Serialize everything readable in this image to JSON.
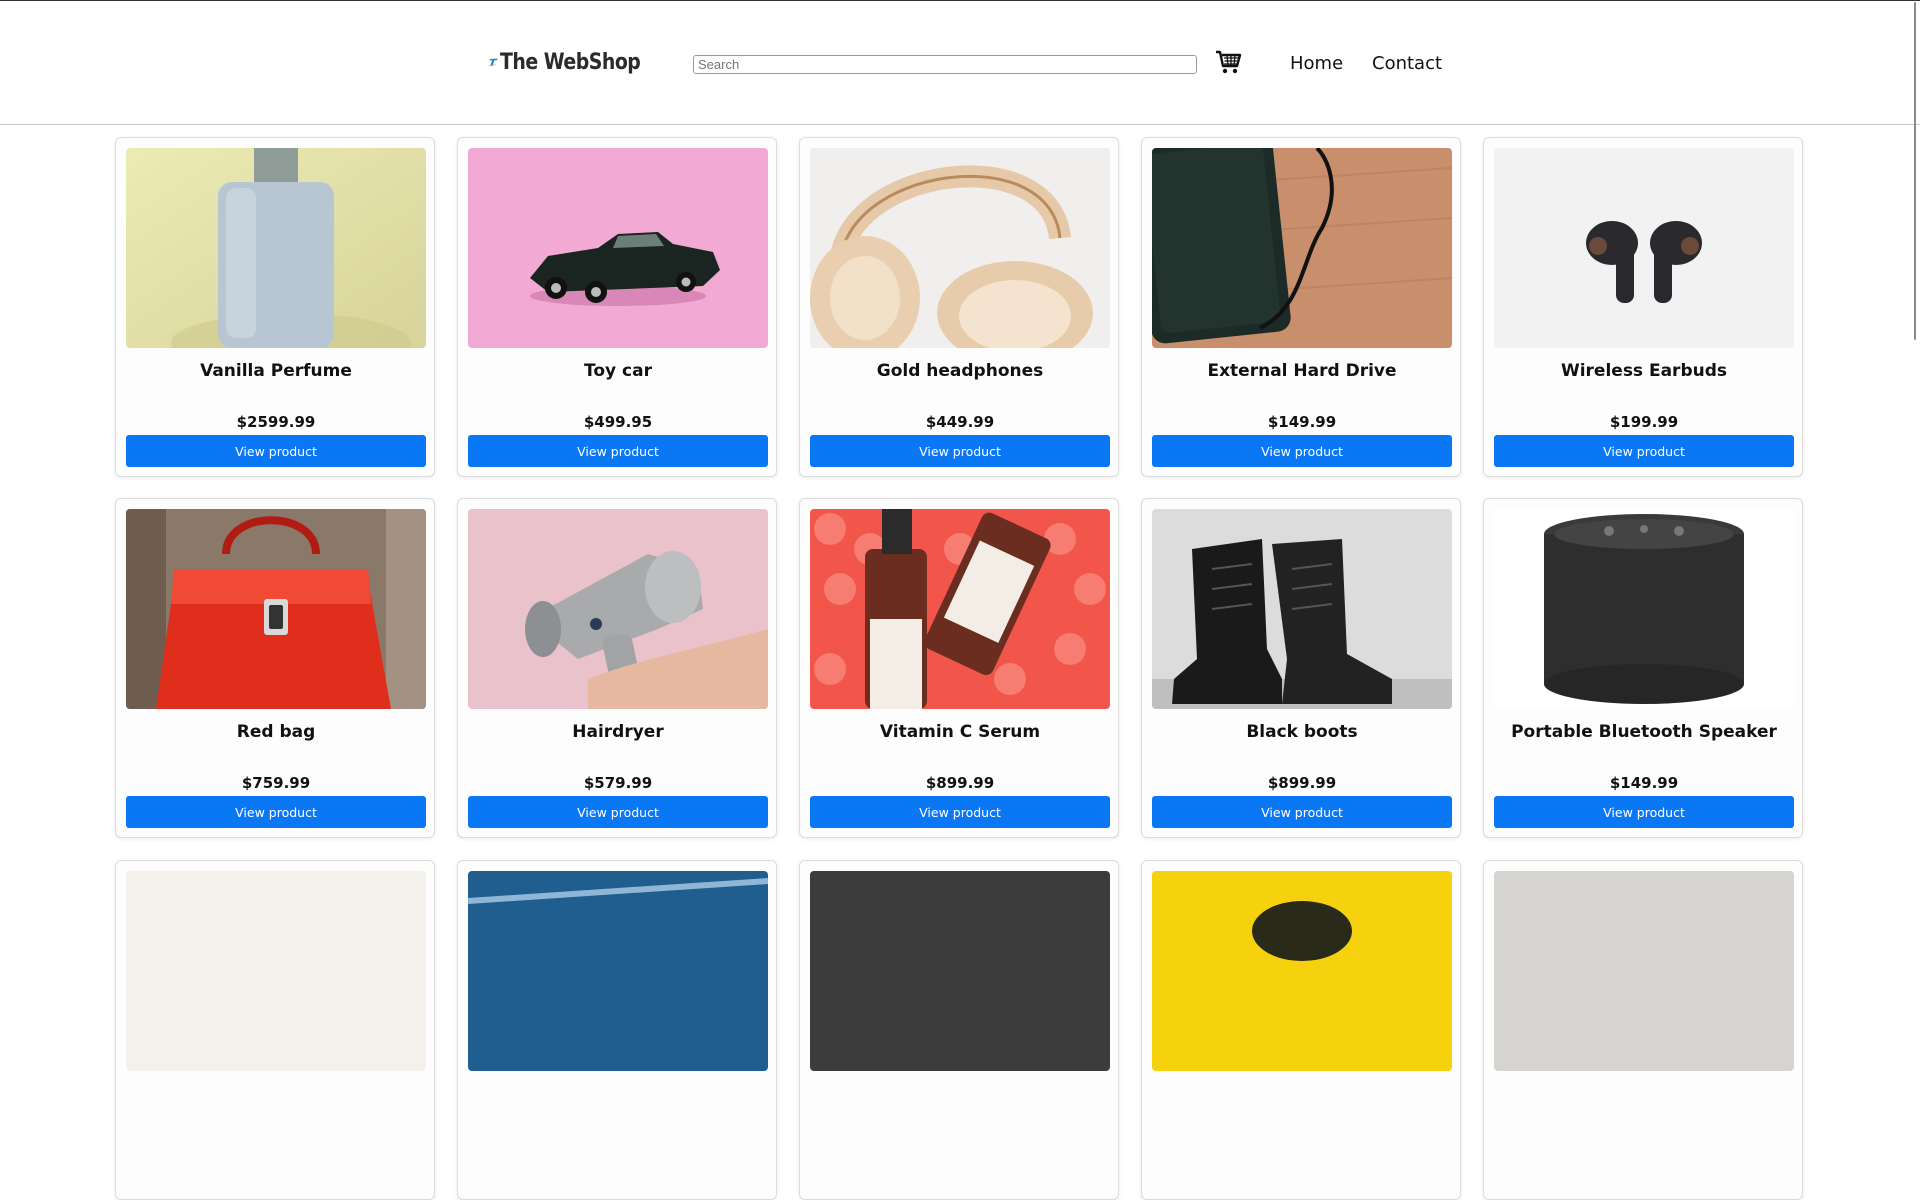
{
  "brand": {
    "name": "The WebShop",
    "logo_icon": "webshop-t-logo-icon"
  },
  "search": {
    "placeholder": "Search",
    "value": ""
  },
  "cart": {
    "icon": "shopping-cart-icon"
  },
  "nav": {
    "home": "Home",
    "contact": "Contact"
  },
  "colors": {
    "button": "#0a78f5",
    "logo_blue": "#1e82c8",
    "logo_orange": "#e8672a"
  },
  "products": [
    {
      "name": "Vanilla Perfume",
      "price": "$2599.99",
      "button": "View product",
      "image": "perfume-bottle-image"
    },
    {
      "name": "Toy car",
      "price": "$499.95",
      "button": "View product",
      "image": "toy-car-image"
    },
    {
      "name": "Gold headphones",
      "price": "$449.99",
      "button": "View product",
      "image": "gold-headphones-image"
    },
    {
      "name": "External Hard Drive",
      "price": "$149.99",
      "button": "View product",
      "image": "external-hard-drive-image"
    },
    {
      "name": "Wireless Earbuds",
      "price": "$199.99",
      "button": "View product",
      "image": "wireless-earbuds-image"
    },
    {
      "name": "Red bag",
      "price": "$759.99",
      "button": "View product",
      "image": "red-bag-image"
    },
    {
      "name": "Hairdryer",
      "price": "$579.99",
      "button": "View product",
      "image": "hairdryer-image"
    },
    {
      "name": "Vitamin C Serum",
      "price": "$899.99",
      "button": "View product",
      "image": "vitamin-c-serum-image"
    },
    {
      "name": "Black boots",
      "price": "$899.99",
      "button": "View product",
      "image": "black-boots-image"
    },
    {
      "name": "Portable Bluetooth Speaker",
      "price": "$149.99",
      "button": "View product",
      "image": "bluetooth-speaker-image"
    },
    {
      "name": "",
      "price": "",
      "button": "",
      "image": "partial-product-image-1"
    },
    {
      "name": "",
      "price": "",
      "button": "",
      "image": "partial-product-image-2"
    },
    {
      "name": "",
      "price": "",
      "button": "",
      "image": "partial-product-image-3"
    },
    {
      "name": "",
      "price": "",
      "button": "",
      "image": "partial-product-image-4"
    },
    {
      "name": "",
      "price": "",
      "button": "",
      "image": "partial-product-image-5"
    }
  ]
}
